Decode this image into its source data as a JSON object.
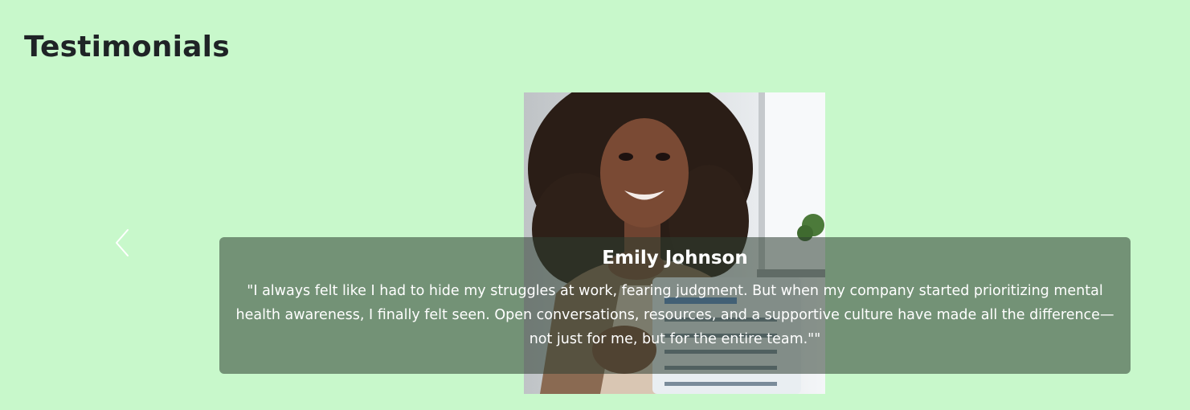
{
  "section": {
    "title": "Testimonials"
  },
  "carousel": {
    "prev_icon": "chevron-left-icon",
    "slide": {
      "photo_description": "portrait-photo",
      "name": "Emily Johnson",
      "quote": "\"I always felt like I had to hide my struggles at work, fearing judgment. But when my company started prioritizing mental health awareness, I finally felt seen. Open conversations, resources, and a supportive culture have made all the difference—not just for me, but for the entire team.\"\""
    }
  },
  "colors": {
    "background": "#c8f8cb",
    "title_text": "#1f2326",
    "caption_overlay": "rgba(45, 62, 50, 0.55)",
    "caption_text": "#ffffff"
  }
}
